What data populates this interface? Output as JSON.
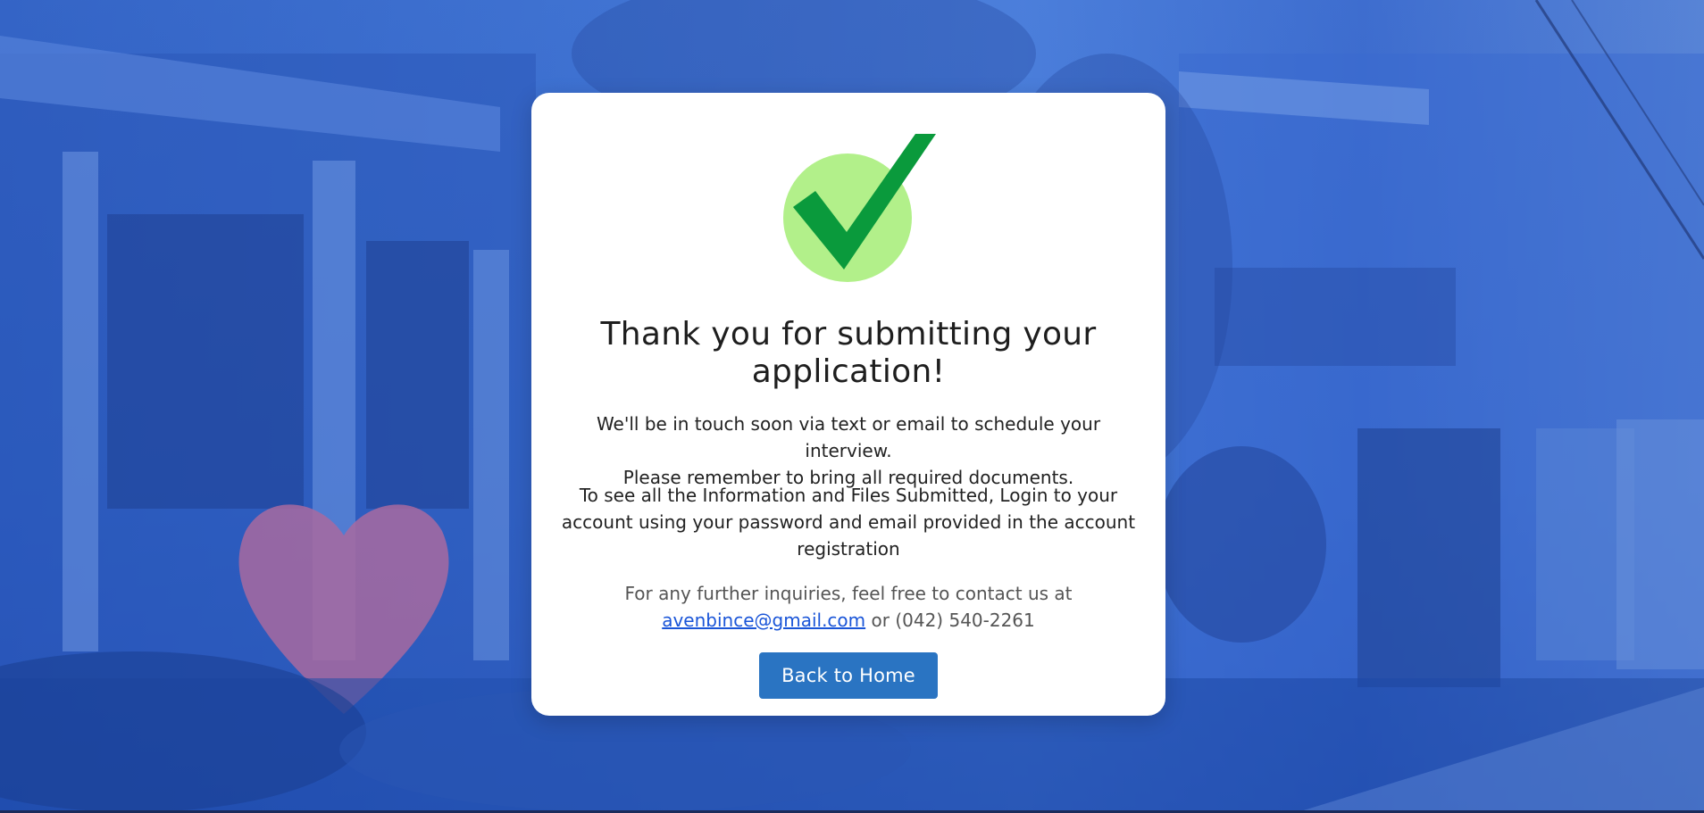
{
  "card": {
    "title": "Thank you for submitting your application!",
    "message_line1": "We'll be in touch soon via text or email to schedule your interview.",
    "message_line2": "Please remember to bring all required documents.",
    "info_text": "To see all the Information and Files Submitted, Login to your account using your password and email provided in the account registration",
    "contact_prefix": "For any further inquiries, feel free to contact us at",
    "contact_email": "avenbince@gmail.com",
    "contact_separator": "or",
    "contact_phone": "(042) 540-2261",
    "button_label": "Back to Home",
    "success_icon": "check-circle-icon"
  },
  "colors": {
    "background_tint": "#2d62c4",
    "card": "#ffffff",
    "check_circle": "#b2f08a",
    "check_mark": "#0a9a3c",
    "button": "#2a74c2",
    "link": "#1a55d8"
  }
}
